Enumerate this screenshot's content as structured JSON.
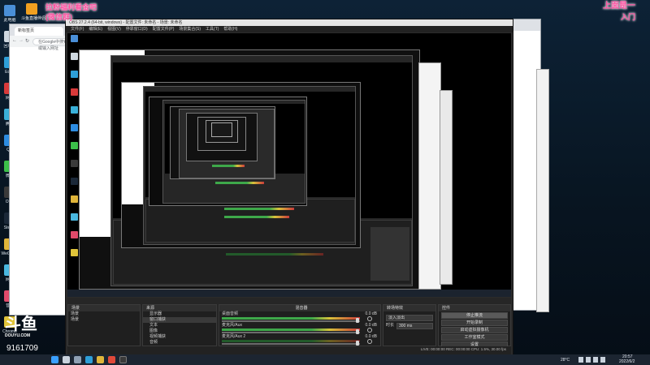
{
  "overlay": {
    "top_line1": "拉粉福利看金吧",
    "top_line2": "(微信群)",
    "right_name": "上面是一",
    "right_sub": "入门",
    "brand": "斗鱼",
    "brand_sub": "DOUYU.COM",
    "room_id": "9161709",
    "logo_label": "斗鱼直播伴侣"
  },
  "desktop_icons": [
    {
      "label": "此电脑",
      "color": "#4a8fd8"
    },
    {
      "label": "回收站",
      "color": "#cfd8e0"
    },
    {
      "label": "Edge",
      "color": "#2e9fd8"
    },
    {
      "label": "网易",
      "color": "#d83a3a"
    },
    {
      "label": "腾讯",
      "color": "#3ab0d8"
    },
    {
      "label": "QQ",
      "color": "#2d8ce0"
    },
    {
      "label": "微信",
      "color": "#3cbf4a"
    },
    {
      "label": "OBS",
      "color": "#3a3a3a"
    },
    {
      "label": "Steam",
      "color": "#1b2838"
    },
    {
      "label": "WeGame",
      "color": "#e0b53a"
    },
    {
      "label": "网盘",
      "color": "#4ab8e0"
    },
    {
      "label": "音乐",
      "color": "#e04a6a"
    },
    {
      "label": "Chrome",
      "color": "#e0c43a"
    }
  ],
  "browser": {
    "tab_label": "新标签页",
    "url_placeholder": "在Google中搜索，或输入网址"
  },
  "obs": {
    "title": "OBS 27.2.4 (64-bit, windows) - 配置文件: 未命名 - 场景: 未命名",
    "menu": [
      "文件(F)",
      "编辑(E)",
      "视图(V)",
      "停靠窗口(D)",
      "配置文件(P)",
      "场景集合(S)",
      "工具(T)",
      "帮助(H)"
    ],
    "source_preview_label": "源属性",
    "source_filter_label": "滤镜",
    "scenes_header": "场景",
    "sources_header": "来源",
    "mixer_header": "混音器",
    "transitions_header": "转场特效",
    "controls_header": "控件",
    "scenes": [
      "场景",
      "场景"
    ],
    "sources": [
      "显示器",
      "窗口捕获",
      "文本",
      "图像",
      "视频捕获",
      "音频"
    ],
    "mixer": [
      {
        "name": "桌面音频",
        "value": "0.0 dB"
      },
      {
        "name": "麦克风/Aux",
        "value": "0.0 dB"
      },
      {
        "name": "麦克风/Aux 2",
        "value": "0.0 dB"
      }
    ],
    "transition": "淡入淡出",
    "duration_label": "时长",
    "duration_value": "300 ms",
    "controls": [
      "停止推流",
      "开始录制",
      "启动虚拟摄像机",
      "工作室模式",
      "设置",
      "退出"
    ],
    "status": "LIVE: 00:00:00   REC: 00:00:00   CPU: 1.5%, 30.00 fps"
  },
  "taskbar": {
    "weather": "28°C",
    "time": "20:57",
    "date": "2022/6/2"
  }
}
